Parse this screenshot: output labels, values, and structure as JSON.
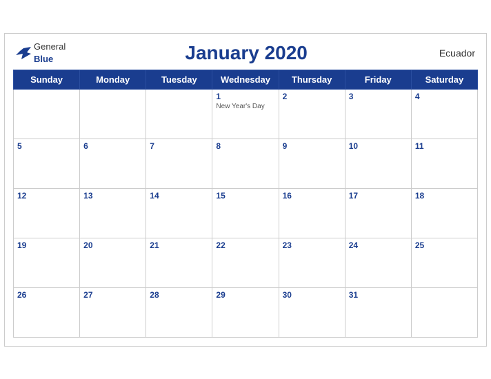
{
  "header": {
    "logo_general": "General",
    "logo_blue": "Blue",
    "title": "January 2020",
    "country": "Ecuador"
  },
  "days_of_week": [
    "Sunday",
    "Monday",
    "Tuesday",
    "Wednesday",
    "Thursday",
    "Friday",
    "Saturday"
  ],
  "weeks": [
    [
      {
        "day": "",
        "empty": true
      },
      {
        "day": "",
        "empty": true
      },
      {
        "day": "",
        "empty": true
      },
      {
        "day": "1",
        "holiday": "New Year's Day"
      },
      {
        "day": "2"
      },
      {
        "day": "3"
      },
      {
        "day": "4"
      }
    ],
    [
      {
        "day": "5"
      },
      {
        "day": "6"
      },
      {
        "day": "7"
      },
      {
        "day": "8"
      },
      {
        "day": "9"
      },
      {
        "day": "10"
      },
      {
        "day": "11"
      }
    ],
    [
      {
        "day": "12"
      },
      {
        "day": "13"
      },
      {
        "day": "14"
      },
      {
        "day": "15"
      },
      {
        "day": "16"
      },
      {
        "day": "17"
      },
      {
        "day": "18"
      }
    ],
    [
      {
        "day": "19"
      },
      {
        "day": "20"
      },
      {
        "day": "21"
      },
      {
        "day": "22"
      },
      {
        "day": "23"
      },
      {
        "day": "24"
      },
      {
        "day": "25"
      }
    ],
    [
      {
        "day": "26"
      },
      {
        "day": "27"
      },
      {
        "day": "28"
      },
      {
        "day": "29"
      },
      {
        "day": "30"
      },
      {
        "day": "31"
      },
      {
        "day": "",
        "empty": true
      }
    ]
  ]
}
